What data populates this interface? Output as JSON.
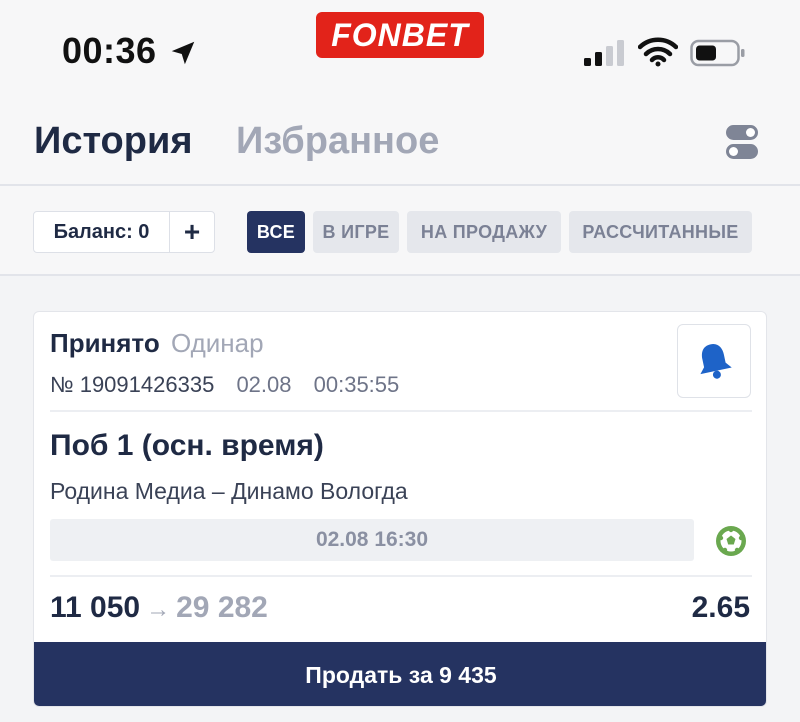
{
  "status_bar": {
    "time": "00:36",
    "brand": "FONBET"
  },
  "header": {
    "tabs": [
      {
        "label": "История",
        "active": true
      },
      {
        "label": "Избранное",
        "active": false
      }
    ]
  },
  "filters": {
    "balance_label": "Баланс: 0",
    "add_label": "+",
    "chips": [
      {
        "label": "ВСЕ",
        "active": true
      },
      {
        "label": "В ИГРЕ",
        "active": false
      },
      {
        "label": "НА ПРОДАЖУ",
        "active": false
      },
      {
        "label": "РАССЧИТАННЫЕ",
        "active": false
      }
    ]
  },
  "bet": {
    "status": "Принято",
    "type": "Одинар",
    "number": "№ 19091426335",
    "date": "02.08",
    "time": "00:35:55",
    "outcome": "Поб 1 (осн. время)",
    "match": "Родина Медиа – Динамо Вологда",
    "event_datetime": "02.08 16:30",
    "stake": "11 050",
    "arrow": "→",
    "payout": "29 282",
    "odds": "2.65",
    "sell_label": "Продать за 9 435"
  },
  "colors": {
    "brand": "#e2231a",
    "primary": "#253361",
    "muted": "#a2a7b6",
    "bell": "#1e63c8",
    "ball": "#6aa84f"
  },
  "icons": [
    "location-arrow-icon",
    "signal-icon",
    "wifi-icon",
    "battery-icon",
    "toggle-settings-icon",
    "bell-icon",
    "soccer-ball-icon"
  ]
}
